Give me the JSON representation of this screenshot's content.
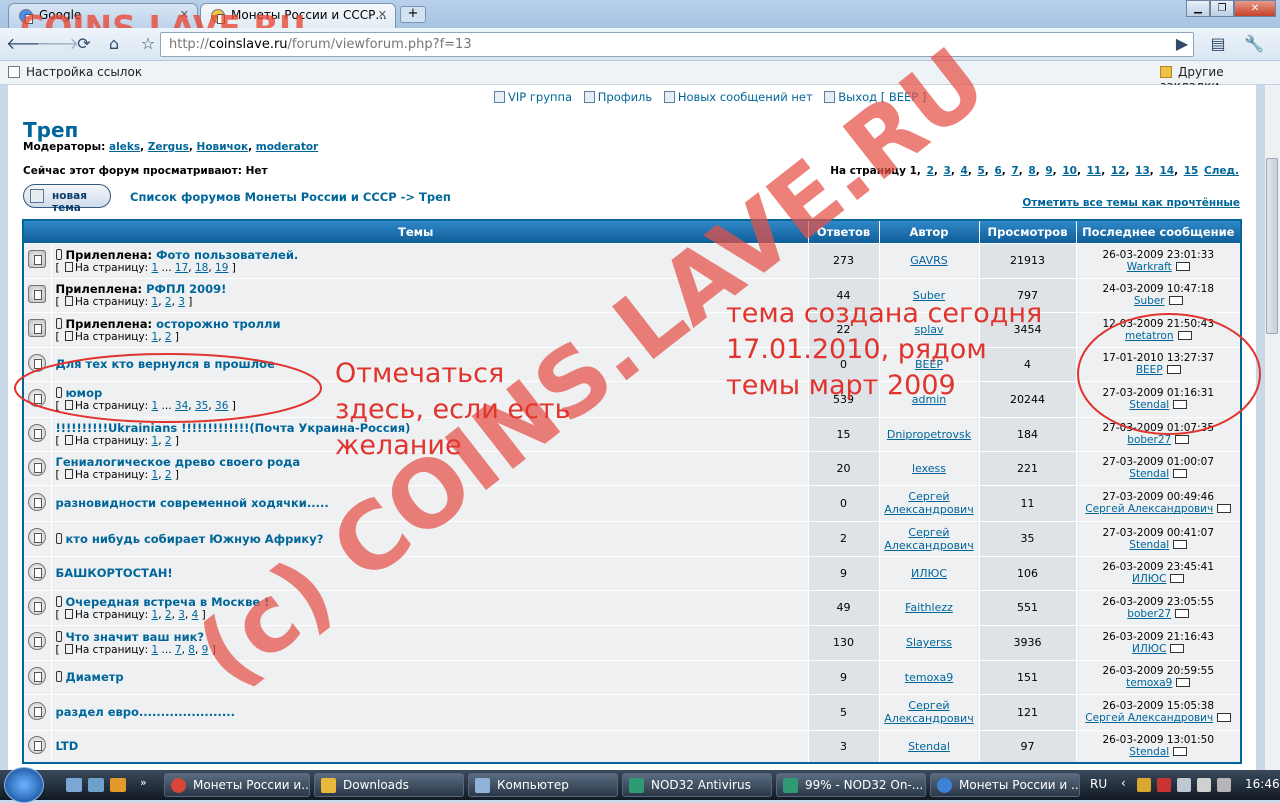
{
  "browser": {
    "tabs": [
      {
        "label": "Google"
      },
      {
        "label": "Монеты России и СССР..."
      }
    ],
    "url_prefix": "http://",
    "url_domain": "coinslave.ru",
    "url_path": "/forum/viewforum.php?f=13",
    "bookmarks_left": "Настройка ссылок",
    "bookmarks_right": "Другие закладки"
  },
  "watermark": "COINS.LAVE.RU",
  "overlay_watermark": "(c) COINS.LAVE.RU",
  "nav": {
    "vip": "VIP группа",
    "profile": "Профиль",
    "new_msgs": "Новых сообщений нет",
    "logout": "Выход [ BEEP ]"
  },
  "forum": {
    "title": "Треп",
    "moderators_label": "Модераторы:",
    "moderators": [
      "aleks",
      "Zergus",
      "Новичок",
      "moderator"
    ],
    "viewing": "Сейчас этот форум просматривают: Нет",
    "pager_label": "На страницу",
    "pages": [
      "1",
      "2",
      "3",
      "4",
      "5",
      "6",
      "7",
      "8",
      "9",
      "10",
      "11",
      "12",
      "13",
      "14",
      "15"
    ],
    "next": "След.",
    "new_topic": "новая тема",
    "breadcrumb": "Список форумов Монеты России и СССР -> Треп",
    "mark_read": "Отметить все темы как прочтённые"
  },
  "table": {
    "headers": {
      "topics": "Темы",
      "replies": "Ответов",
      "author": "Автор",
      "views": "Просмотров",
      "last": "Последнее сообщение"
    },
    "sticky_label": "Прилеплена:",
    "pages_label": "На страницу:",
    "rows": [
      {
        "sticky": true,
        "attach": true,
        "title": "Фото пользователей.",
        "pages": "1 ... 17, 18, 19",
        "replies": "273",
        "author": "GAVRS",
        "views": "21913",
        "last_date": "26-03-2009 23:01:33",
        "last_user": "Warkraft"
      },
      {
        "sticky": true,
        "attach": false,
        "title": "РФПЛ 2009!",
        "pages": "1, 2, 3",
        "replies": "44",
        "author": "Suber",
        "views": "797",
        "last_date": "24-03-2009 10:47:18",
        "last_user": "Suber"
      },
      {
        "sticky": true,
        "attach": true,
        "title": "осторожно тролли",
        "pages": "1, 2",
        "replies": "22",
        "author": "splav",
        "views": "3454",
        "last_date": "12-03-2009 21:50:43",
        "last_user": "metatron"
      },
      {
        "sticky": false,
        "attach": false,
        "title": "Для тех кто вернулся в прошлое",
        "pages": "",
        "replies": "0",
        "author": "BEEP",
        "views": "4",
        "last_date": "17-01-2010 13:27:37",
        "last_user": "BEEP"
      },
      {
        "sticky": false,
        "attach": true,
        "title": "юмор",
        "pages": "1 ... 34, 35, 36",
        "replies": "539",
        "author": "admin",
        "views": "20244",
        "last_date": "27-03-2009 01:16:31",
        "last_user": "Stendal"
      },
      {
        "sticky": false,
        "attach": false,
        "title": "!!!!!!!!!!Ukrainians !!!!!!!!!!!!!(Почта Украина-Россия)",
        "pages": "1, 2",
        "replies": "15",
        "author": "Dnipropetrovsk",
        "views": "184",
        "last_date": "27-03-2009 01:07:35",
        "last_user": "bober27"
      },
      {
        "sticky": false,
        "attach": false,
        "title": "Гениалогическое древо своего рода",
        "pages": "1, 2",
        "replies": "20",
        "author": "lexess",
        "views": "221",
        "last_date": "27-03-2009 01:00:07",
        "last_user": "Stendal"
      },
      {
        "sticky": false,
        "attach": false,
        "title": "разновидности современной ходячки.....",
        "pages": "",
        "replies": "0",
        "author": "Сергей Александрович",
        "views": "11",
        "last_date": "27-03-2009 00:49:46",
        "last_user": "Сергей Александрович"
      },
      {
        "sticky": false,
        "attach": true,
        "title": "кто нибудь собирает Южную Африку?",
        "pages": "",
        "replies": "2",
        "author": "Сергей Александрович",
        "views": "35",
        "last_date": "27-03-2009 00:41:07",
        "last_user": "Stendal"
      },
      {
        "sticky": false,
        "attach": false,
        "title": "БАШКОРТОСТАН!",
        "pages": "",
        "replies": "9",
        "author": "ИЛЮС",
        "views": "106",
        "last_date": "26-03-2009 23:45:41",
        "last_user": "ИЛЮС"
      },
      {
        "sticky": false,
        "attach": true,
        "title": "Очередная встреча в Москве !",
        "pages": "1, 2, 3, 4",
        "replies": "49",
        "author": "Faithlezz",
        "views": "551",
        "last_date": "26-03-2009 23:05:55",
        "last_user": "bober27"
      },
      {
        "sticky": false,
        "attach": true,
        "title": "Что значит ваш ник?",
        "pages": "1 ... 7, 8, 9",
        "replies": "130",
        "author": "Slayerss",
        "views": "3936",
        "last_date": "26-03-2009 21:16:43",
        "last_user": "ИЛЮС"
      },
      {
        "sticky": false,
        "attach": true,
        "title": "Диаметр",
        "pages": "",
        "replies": "9",
        "author": "temoxa9",
        "views": "151",
        "last_date": "26-03-2009 20:59:55",
        "last_user": "temoxa9"
      },
      {
        "sticky": false,
        "attach": false,
        "title": "раздел евро......................",
        "pages": "",
        "replies": "5",
        "author": "Сергей Александрович",
        "views": "121",
        "last_date": "26-03-2009 15:05:38",
        "last_user": "Сергей Александрович"
      },
      {
        "sticky": false,
        "attach": false,
        "title": "LTD",
        "pages": "",
        "replies": "3",
        "author": "Stendal",
        "views": "97",
        "last_date": "26-03-2009 13:01:50",
        "last_user": "Stendal"
      }
    ]
  },
  "annotations": {
    "left": "Отмечаться\nздесь, если есть\nжелание",
    "right": "тема создана сегодня\n17.01.2010, рядом\nтемы март 2009"
  },
  "taskbar": {
    "items": [
      "Монеты России и...",
      "Downloads",
      "Компьютер",
      "NOD32 Antivirus",
      "99% - NOD32 On-...",
      "Монеты России и ..."
    ],
    "lang": "RU",
    "clock": "16:46"
  }
}
